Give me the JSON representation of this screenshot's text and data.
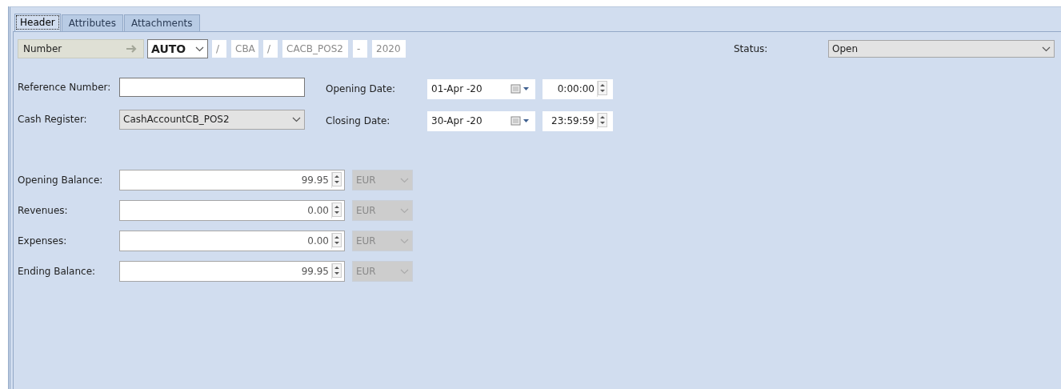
{
  "tabs": [
    {
      "label": "Header",
      "selected": true
    },
    {
      "label": "Attributes",
      "selected": false
    },
    {
      "label": "Attachments",
      "selected": false
    }
  ],
  "number": {
    "label": "Number",
    "parts": [
      {
        "kind": "select",
        "value": "AUTO"
      },
      {
        "kind": "field",
        "value": "/"
      },
      {
        "kind": "field",
        "value": "CBA"
      },
      {
        "kind": "field",
        "value": "/"
      },
      {
        "kind": "field",
        "value": "CACB_POS2"
      },
      {
        "kind": "field",
        "value": "-"
      },
      {
        "kind": "field",
        "value": "2020"
      }
    ]
  },
  "status": {
    "label": "Status:",
    "value": "Open"
  },
  "left_fields": [
    {
      "kind": "text",
      "label": "Reference Number:"
    },
    {
      "kind": "select",
      "label": "Cash Register:",
      "value": "CashAccountCB_POS2"
    }
  ],
  "dates": [
    {
      "label": "Opening Date:",
      "date": "01-Apr -20",
      "time": "0:00:00"
    },
    {
      "label": "Closing Date:",
      "date": "30-Apr -20",
      "time": "23:59:59"
    }
  ],
  "balances": [
    {
      "label": "Opening Balance:",
      "value": "99.95",
      "currency": "EUR",
      "disabled": true
    },
    {
      "label": "Revenues:",
      "value": "0.00",
      "currency": "EUR",
      "disabled": true
    },
    {
      "label": "Expenses:",
      "value": "0.00",
      "currency": "EUR",
      "disabled": true
    },
    {
      "label": "Ending Balance:",
      "value": "99.95",
      "currency": "EUR",
      "disabled": true
    }
  ]
}
